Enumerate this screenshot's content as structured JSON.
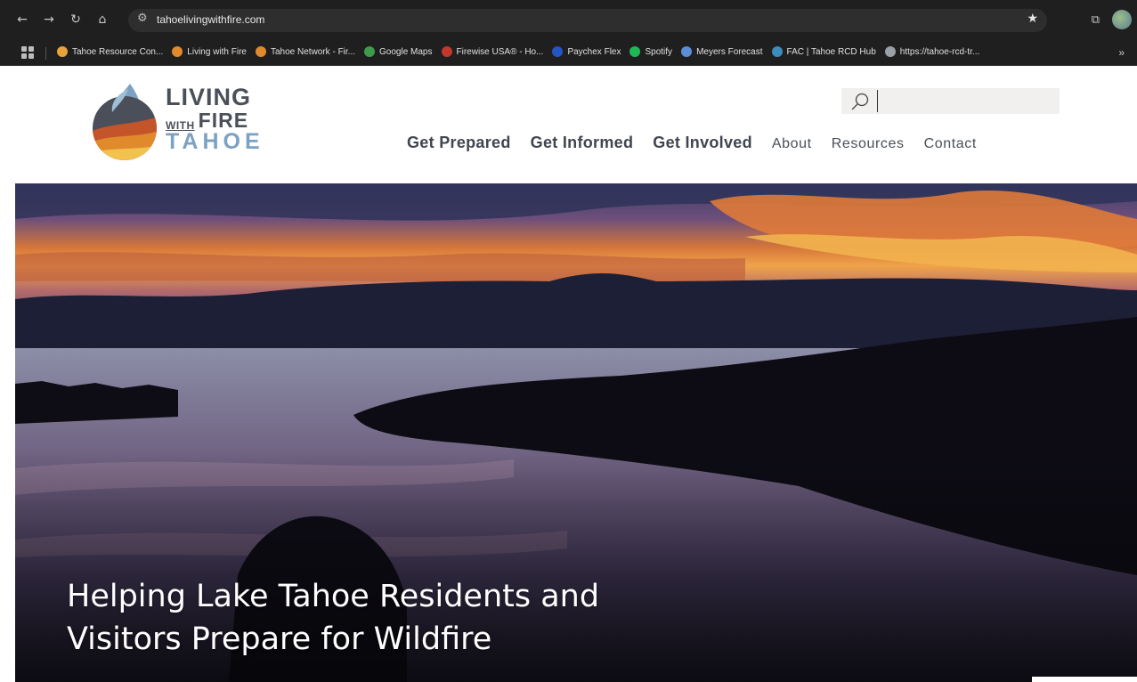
{
  "browser": {
    "url": "tahoelivingwithfire.com",
    "bookmarks": [
      {
        "label": "Tahoe Resource Con...",
        "color": "#e8a23a"
      },
      {
        "label": "Living with Fire",
        "color": "#e08a2c"
      },
      {
        "label": "Tahoe Network - Fir...",
        "color": "#e08a2c"
      },
      {
        "label": "Google Maps",
        "color": "#3d9b4c"
      },
      {
        "label": "Firewise USA® - Ho...",
        "color": "#c0392b"
      },
      {
        "label": "Paychex Flex",
        "color": "#2455c3"
      },
      {
        "label": "Spotify",
        "color": "#1db954"
      },
      {
        "label": "Meyers Forecast",
        "color": "#5a8fd8"
      },
      {
        "label": "FAC | Tahoe RCD Hub",
        "color": "#3c8dbc"
      },
      {
        "label": "https://tahoe-rcd-tr...",
        "color": "#9aa0a6"
      }
    ],
    "more_label": "»"
  },
  "logo": {
    "line1": "LIVING",
    "with": "WITH",
    "fire": "FIRE",
    "line3": "TAHOE"
  },
  "search": {
    "placeholder": ""
  },
  "nav": {
    "primary": [
      "Get Prepared",
      "Get Informed",
      "Get Involved"
    ],
    "secondary": [
      "About",
      "Resources",
      "Contact"
    ]
  },
  "hero": {
    "title_line1": "Helping Lake Tahoe Residents and",
    "title_line2": "Visitors Prepare for Wildfire"
  },
  "colors": {
    "chrome_bg": "#1f1f1f",
    "nav_text": "#404550",
    "logo_dark": "#4a4f5a",
    "logo_blue": "#7ba2c2"
  }
}
